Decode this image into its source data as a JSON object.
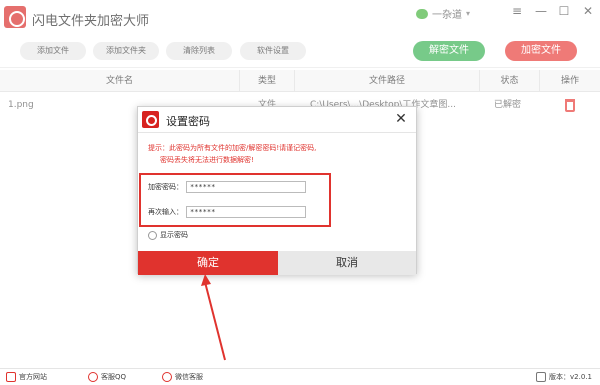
{
  "app": {
    "title": "闪电文件夹加密大师",
    "user": "一杂道"
  },
  "window_controls": {
    "menu": "≡",
    "minimize": "—",
    "maximize": "☐",
    "close": "✕"
  },
  "toolbar": {
    "add_file": "添加文件",
    "add_folder": "添加文件夹",
    "clear_list": "清除列表",
    "settings": "软件设置",
    "decrypt": "解密文件",
    "encrypt": "加密文件"
  },
  "table": {
    "headers": {
      "name": "文件名",
      "type": "类型",
      "path": "文件路径",
      "status": "状态",
      "action": "操作"
    },
    "rows": [
      {
        "name": "1.png",
        "type": "文件",
        "path": "C:\\Users\\...\\Desktop\\工作文章图...",
        "status": "已解密"
      }
    ]
  },
  "dialog": {
    "title": "设置密码",
    "tip_line1": "提示：此密码为所有文件的加密/解密密码!请谨记密码,",
    "tip_line2": "密码丢失将无法进行数据解密!",
    "encrypt_label": "加密密码：",
    "encrypt_value": "******",
    "confirm_label": "再次输入：",
    "confirm_value": "******",
    "show_password": "显示密码",
    "ok": "确定",
    "cancel": "取消"
  },
  "footer": {
    "website": "官方网站",
    "qq": "客服QQ",
    "wechat": "微信客服",
    "version": "版本：v2.0.1"
  },
  "colors": {
    "accent_red": "#e0332e",
    "green": "#2fae4a"
  }
}
